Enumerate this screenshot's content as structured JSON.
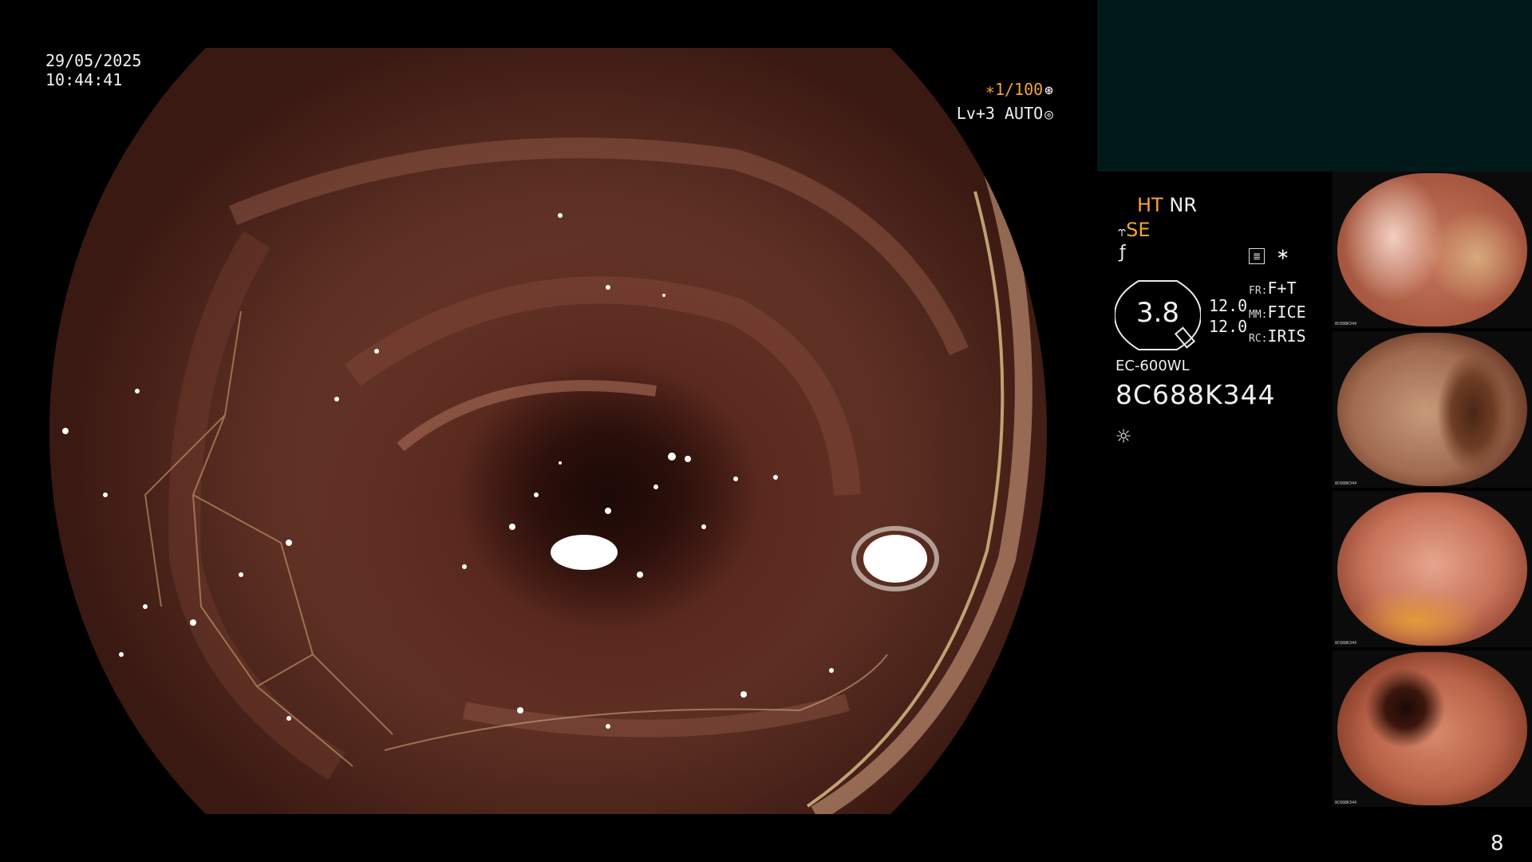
{
  "osd": {
    "date": "29/05/2025",
    "time": "10:44:41",
    "shutter": "∗1/100",
    "level": "Lv+3 AUTO"
  },
  "panel": {
    "mode_ht": "HT",
    "mode_nr": "NR",
    "mode_se": "SE",
    "memo_mark": "∗",
    "gauge_value": "3.8",
    "fr_value_top": "12.0",
    "fr_value_bottom": "12.0",
    "fr_key": "FR:",
    "fr_val": "F+T",
    "mm_key": "MM:",
    "mm_val": "FICE",
    "rc_key": "RC:",
    "rc_val": "IRIS",
    "scope_model": "EC-600WL",
    "scope_serial": "8C688K344"
  },
  "thumbnails": [
    {
      "caption": "8C688K344"
    },
    {
      "caption": "8C688K344"
    },
    {
      "caption": "8C688K344"
    },
    {
      "caption": "8C688K344"
    }
  ],
  "page_number": "8",
  "icons": {
    "shutter": "aperture-icon",
    "auto": "iris-icon",
    "se_mark": "structure-enhance-icon",
    "f_mark": "function-icon",
    "memo": "record-icon",
    "light": "light-icon"
  },
  "colors": {
    "accent": "#f2a33a",
    "panel_box": "#02191a"
  }
}
